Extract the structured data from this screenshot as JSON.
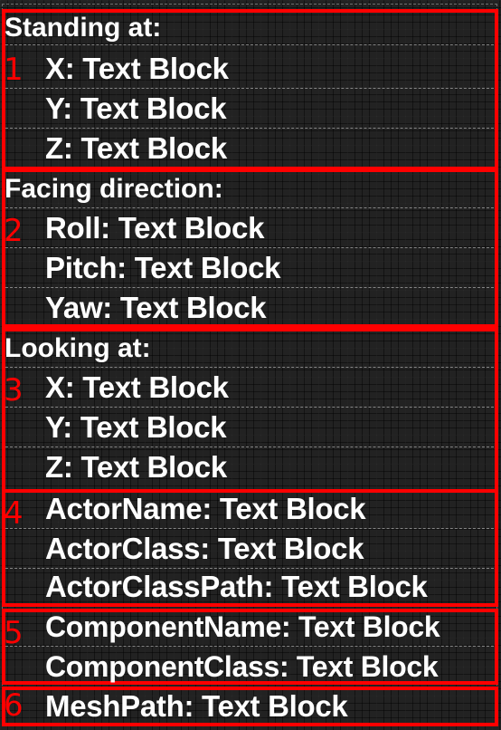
{
  "sections": [
    {
      "number": "1",
      "heading": "Standing at:",
      "rows": [
        {
          "label": "X:",
          "value": "Text Block"
        },
        {
          "label": "Y:",
          "value": "Text Block"
        },
        {
          "label": "Z:",
          "value": "Text Block"
        }
      ]
    },
    {
      "number": "2",
      "heading": "Facing direction:",
      "rows": [
        {
          "label": "Roll:",
          "value": "Text Block"
        },
        {
          "label": "Pitch:",
          "value": "Text Block"
        },
        {
          "label": "Yaw:",
          "value": "Text Block"
        }
      ]
    },
    {
      "number": "3",
      "heading": "Looking at:",
      "rows": [
        {
          "label": "X:",
          "value": "Text Block"
        },
        {
          "label": "Y:",
          "value": "Text Block"
        },
        {
          "label": "Z:",
          "value": "Text Block"
        }
      ]
    },
    {
      "number": "4",
      "rows": [
        {
          "label": "ActorName:",
          "value": "Text Block"
        },
        {
          "label": "ActorClass:",
          "value": "Text Block"
        },
        {
          "label": "ActorClassPath:",
          "value": "Text Block"
        }
      ]
    },
    {
      "number": "5",
      "rows": [
        {
          "label": "ComponentName:",
          "value": "Text Block"
        },
        {
          "label": "ComponentClass:",
          "value": "Text Block"
        }
      ]
    },
    {
      "number": "6",
      "rows": [
        {
          "label": "MeshPath:",
          "value": "Text Block"
        }
      ]
    }
  ],
  "colors": {
    "canvas_background": "#222222",
    "section_border": "#ff0000",
    "section_number": "#ff0000",
    "text": "#ffffff"
  }
}
